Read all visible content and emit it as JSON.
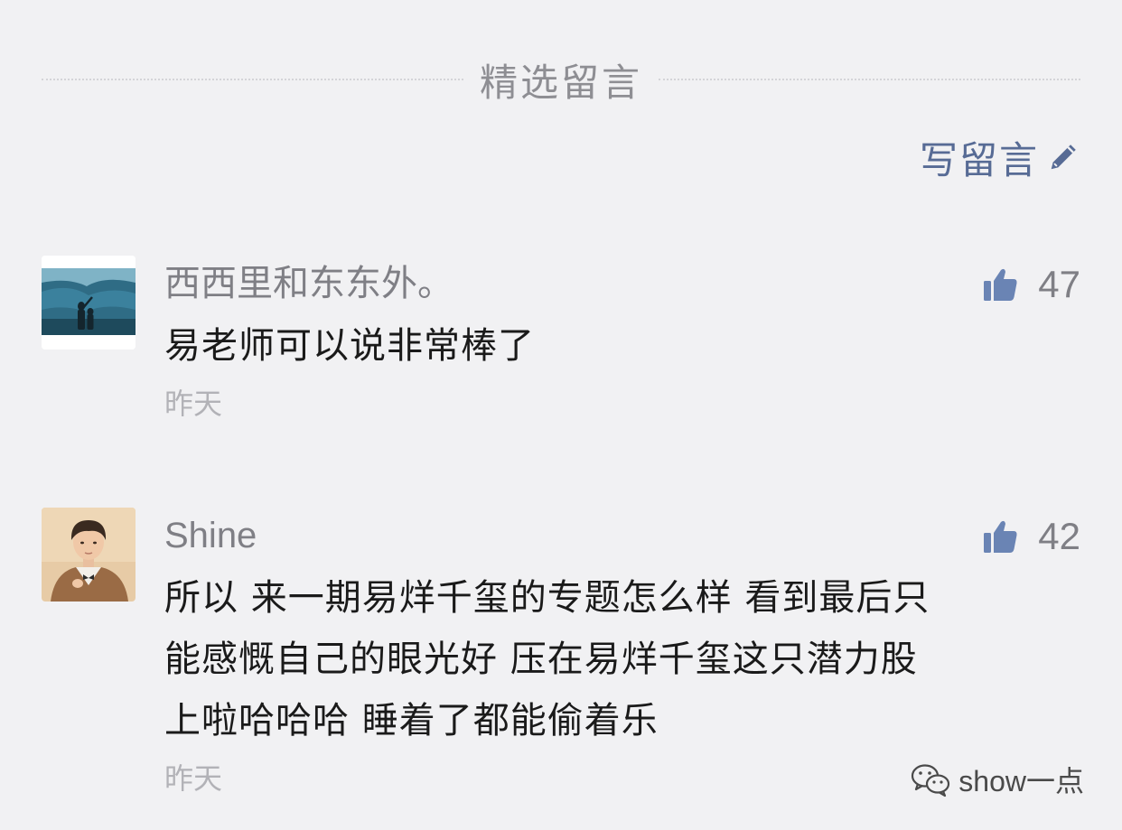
{
  "section": {
    "title": "精选留言"
  },
  "write_comment": {
    "label": "写留言",
    "icon": "pencil-icon"
  },
  "comments": [
    {
      "nickname": "西西里和东东外。",
      "content": "易老师可以说非常棒了",
      "time": "昨天",
      "likes": "47",
      "avatar": "scenery-avatar"
    },
    {
      "nickname": "Shine",
      "content": "所以 来一期易烊千玺的专题怎么样 看到最后只\n能感慨自己的眼光好 压在易烊千玺这只潜力股\n上啦哈哈哈 睡着了都能偷着乐",
      "time": "昨天",
      "likes": "42",
      "avatar": "portrait-avatar"
    }
  ],
  "watermark": {
    "text": "show一点",
    "icon": "wechat-icon"
  },
  "colors": {
    "background": "#f1f1f3",
    "link": "#576b95",
    "muted": "#7f7f85",
    "text": "#1a1a1a",
    "like_icon": "#6a84b4"
  }
}
